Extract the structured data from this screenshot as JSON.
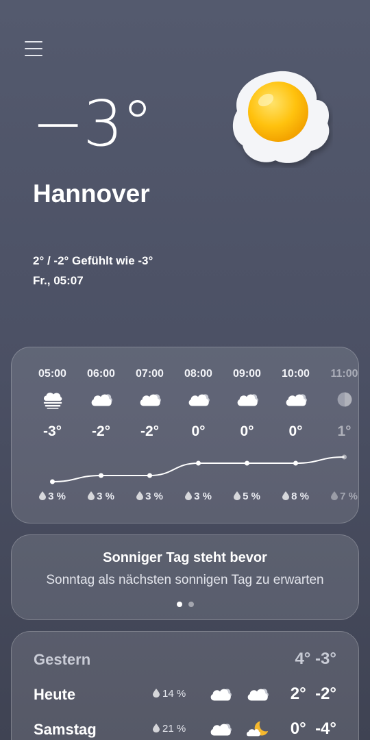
{
  "header": {
    "menu_icon": "hamburger-menu-icon",
    "current_temp": "−3°",
    "city": "Hannover",
    "hi_lo_feels": "2° / -2° Gefühlt wie -3°",
    "datetime": "Fr., 05:07",
    "condition_icon": "clear-sky-sun-icon"
  },
  "hourly": [
    {
      "time": "05:00",
      "icon": "fog-icon",
      "temp": "-3°",
      "rain": "3 %"
    },
    {
      "time": "06:00",
      "icon": "cloudy-icon",
      "temp": "-2°",
      "rain": "3 %"
    },
    {
      "time": "07:00",
      "icon": "cloudy-icon",
      "temp": "-2°",
      "rain": "3 %"
    },
    {
      "time": "08:00",
      "icon": "cloudy-icon",
      "temp": "0°",
      "rain": "3 %"
    },
    {
      "time": "09:00",
      "icon": "cloudy-icon",
      "temp": "0°",
      "rain": "5 %"
    },
    {
      "time": "10:00",
      "icon": "cloudy-icon",
      "temp": "0°",
      "rain": "8 %"
    },
    {
      "time": "11:00",
      "icon": "partly-sunny-icon",
      "temp": "1°",
      "rain": "7 %"
    }
  ],
  "hourly_temps": [
    -3,
    -2,
    -2,
    0,
    0,
    0,
    1
  ],
  "suggestion": {
    "title": "Sonniger Tag steht bevor",
    "text": "Sonntag als nächsten sonnigen Tag zu erwarten"
  },
  "daily": [
    {
      "day": "Gestern",
      "rain": "",
      "icon1": "",
      "icon2": "",
      "temps": "4° -3°"
    },
    {
      "day": "Heute",
      "rain": "14 %",
      "icon1": "cloudy-icon",
      "icon2": "cloudy-icon",
      "temps": "2°  -2°"
    },
    {
      "day": "Samstag",
      "rain": "21 %",
      "icon1": "cloudy-icon",
      "icon2": "moon-cloud-icon",
      "temps": "0°  -4°"
    }
  ],
  "colors": {
    "background_top": "#545a6e",
    "background_bottom": "#3f4353",
    "sun_yolk": "#ffc20e",
    "moon": "#f5b82e"
  }
}
